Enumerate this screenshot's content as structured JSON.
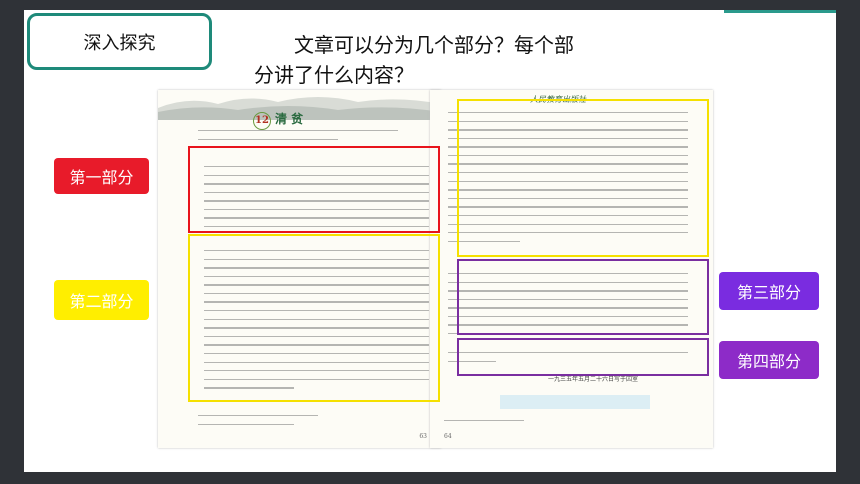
{
  "tab": {
    "label": "深入探究"
  },
  "question": {
    "line1": "文章可以分为几个部分？每个部",
    "line2": "分讲了什么内容？"
  },
  "left_page": {
    "chapter_number": "12",
    "chapter_title": "清 贫",
    "page_number": "63"
  },
  "right_page": {
    "header": "人民教育出版社",
    "dateline": "一九三五年五月二十六日写于囚室",
    "page_number": "64"
  },
  "labels": {
    "part1": "第一部分",
    "part2": "第二部分",
    "part3": "第三部分",
    "part4": "第四部分"
  },
  "colors": {
    "part1": "#e81b2a",
    "part2": "#ffee00",
    "part3": "#7a2ce0",
    "part4": "#8d2bc8",
    "tab_border": "#1e8a7a"
  }
}
